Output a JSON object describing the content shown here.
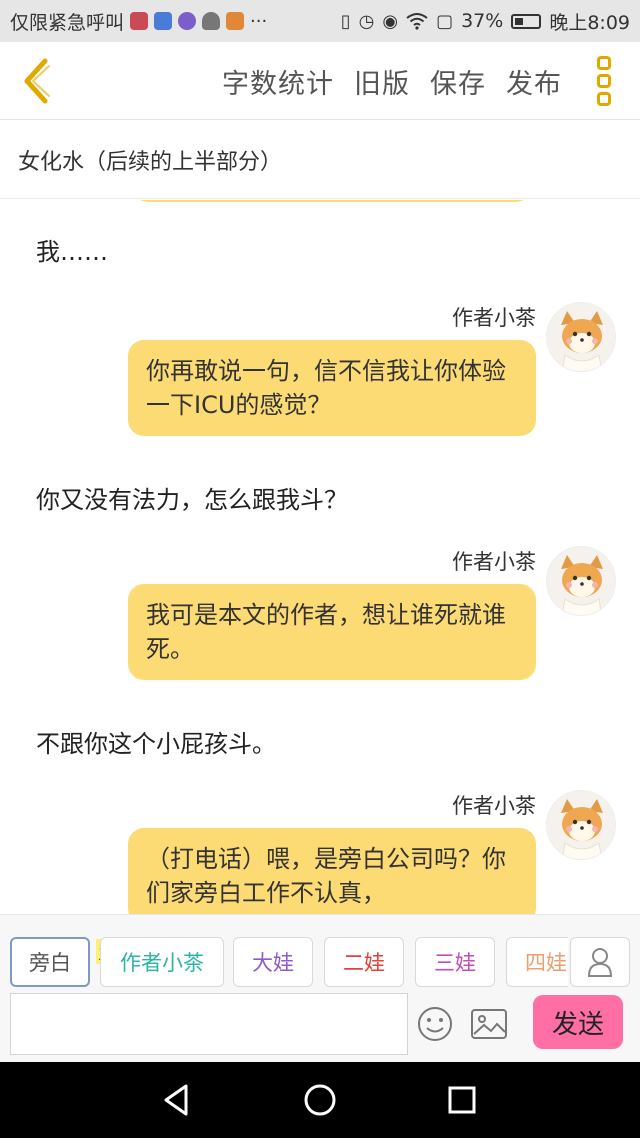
{
  "status_bar": {
    "notification_text": "仅限紧急呼叫",
    "more": "···",
    "battery": "37%",
    "time": "晚上8:09",
    "app_icons": [
      "#c94b55",
      "#4a7bd6",
      "#7b5ec9",
      "#777777",
      "#e0873a"
    ]
  },
  "header": {
    "actions": [
      "字数统计",
      "旧版",
      "保存",
      "发布"
    ]
  },
  "chapter": {
    "title": "女化水（后续的上半部分）"
  },
  "messages": {
    "narration_1": "我……",
    "author_1_name": "作者小茶",
    "bubble_1": "你再敢说一句，信不信我让你体验一下ICU的感觉？",
    "narration_2": "你又没有法力，怎么跟我斗？",
    "author_2_name": "作者小茶",
    "bubble_2": "我可是本文的作者，想让谁死就谁死。",
    "narration_3": "不跟你这个小屁孩斗。",
    "author_3_name": "作者小茶",
    "bubble_3": "（打电话）喂，是旁白公司吗？你们家旁白工作不认真，"
  },
  "roles": {
    "main_tag": "主",
    "items": [
      {
        "label": "旁白",
        "color": "#555555"
      },
      {
        "label": "作者小茶",
        "color": "#2bb5a6"
      },
      {
        "label": "大娃",
        "color": "#8e5bc9"
      },
      {
        "label": "二娃",
        "color": "#e0423a"
      },
      {
        "label": "三娃",
        "color": "#c24fb5"
      },
      {
        "label": "四娃",
        "color": "#e8a071"
      }
    ]
  },
  "composer": {
    "input_value": "",
    "send_label": "发送"
  }
}
